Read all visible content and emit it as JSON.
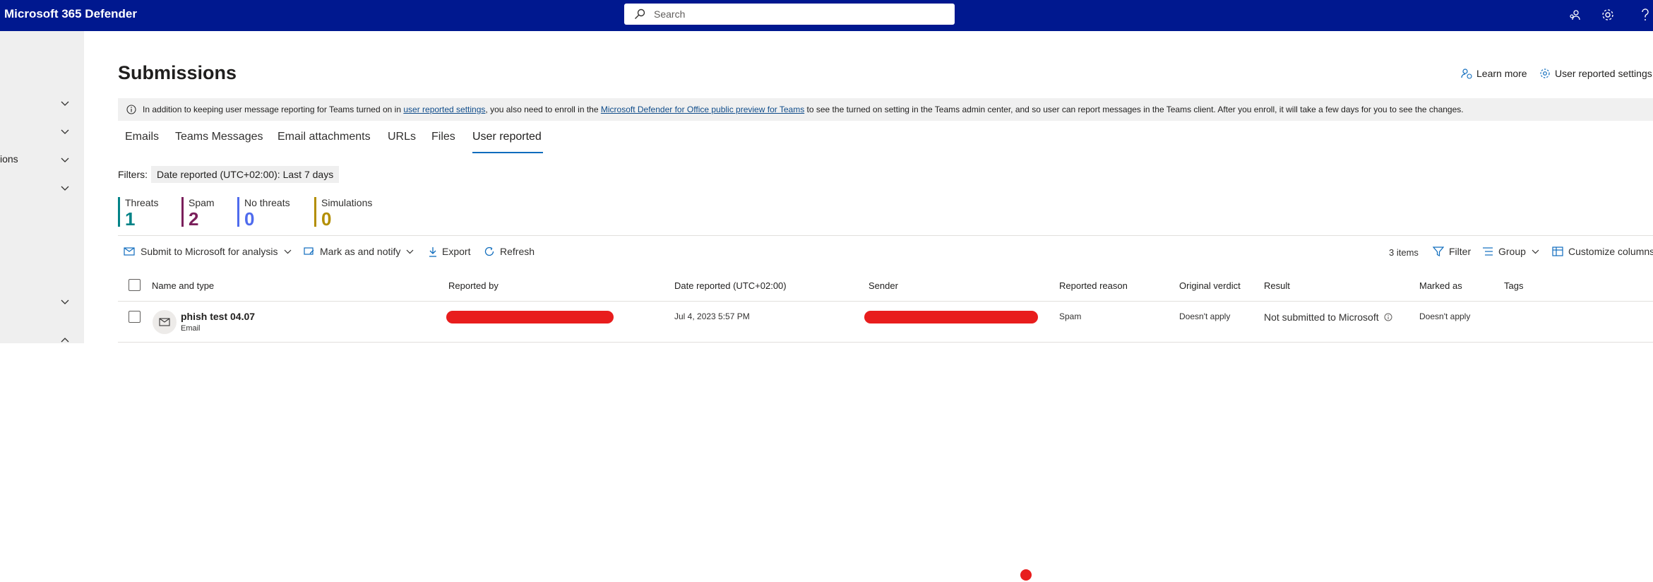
{
  "app": {
    "title": "Microsoft 365 Defender"
  },
  "search": {
    "placeholder": "Search",
    "value": ""
  },
  "topbar_icons": [
    "people-icon",
    "gear-icon",
    "help-icon"
  ],
  "nav": {
    "items": [
      {
        "label": ""
      },
      {
        "label": ""
      },
      {
        "label": "ions"
      },
      {
        "label": ""
      },
      {
        "label": ""
      },
      {
        "label": ""
      }
    ]
  },
  "page": {
    "title": "Submissions",
    "learn_more": "Learn more",
    "user_reported_settings": "User reported settings"
  },
  "banner": {
    "t1": "In addition to keeping user message reporting for Teams turned on in ",
    "link1": "user reported settings",
    "t2": ", you also need to enroll in the ",
    "link2": "Microsoft Defender for Office public preview for Teams",
    "t3": " to see the turned on setting in the Teams admin center, and so user can report messages in the Teams client. After you enroll, it will take a few days for you to see the changes."
  },
  "tabs": [
    "Emails",
    "Teams Messages",
    "Email attachments",
    "URLs",
    "Files",
    "User reported"
  ],
  "active_tab": "User reported",
  "filters": {
    "label": "Filters:",
    "chip_name": "Date reported (UTC+02:00):",
    "chip_value": "Last 7 days"
  },
  "stats": [
    {
      "label": "Threats",
      "value": "1",
      "color": "#038387"
    },
    {
      "label": "Spam",
      "value": "2",
      "color": "#7a1f5b"
    },
    {
      "label": "No threats",
      "value": "0",
      "color": "#4f6bed"
    },
    {
      "label": "Simulations",
      "value": "0",
      "color": "#b38e00"
    }
  ],
  "toolbar": {
    "submit": "Submit to Microsoft for analysis",
    "mark": "Mark as and notify",
    "export": "Export",
    "refresh": "Refresh",
    "count": "3 items",
    "filter": "Filter",
    "group": "Group",
    "customize": "Customize columns"
  },
  "table": {
    "columns": [
      "Name and type",
      "Reported by",
      "Date reported (UTC+02:00)",
      "Sender",
      "Reported reason",
      "Original verdict",
      "Result",
      "Marked as",
      "Tags"
    ],
    "rows": [
      {
        "name": "phish test 04.07",
        "type": "Email",
        "date": "Jul 4, 2023 5:57 PM",
        "reason": "Spam",
        "verdict": "Doesn't apply",
        "result": "Not submitted to Microsoft",
        "marked": "Doesn't apply",
        "tags": ""
      }
    ]
  },
  "colors": {
    "topbar": "#00188f",
    "accent": "#0f6cbd",
    "redaction": "#e81d1d",
    "link": "#0f4c8a"
  }
}
